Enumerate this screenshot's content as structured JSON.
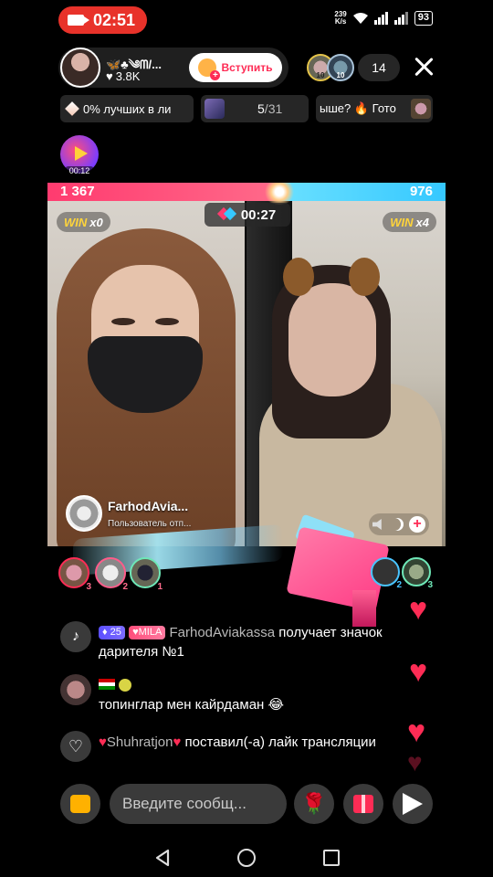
{
  "status_bar": {
    "recording_time": "02:51",
    "net_speed_value": "239",
    "net_speed_unit": "K/s",
    "battery": "93"
  },
  "host": {
    "name": "🦋♣༄ᗰ/...",
    "likes": "3.8K",
    "join_label": "Вступить"
  },
  "viewers": {
    "badge_1": "10",
    "badge_2": "10",
    "count": "14"
  },
  "chips": {
    "rank_text": "0% лучших в ли",
    "goal_progress": "5",
    "goal_total": "31",
    "ticker_text": "ыше? 🔥 Гото"
  },
  "live_badge_time": "00:12",
  "battle": {
    "score_left": "1 367",
    "score_right": "976",
    "score_left_share": 0.583,
    "timer": "00:27",
    "win_word": "WIN",
    "win_left": "x0",
    "win_right": "x4",
    "opponent_name": "FarhodAvia...",
    "opponent_sub": "Пользователь отп..."
  },
  "gifters": {
    "ranks": [
      "3",
      "2",
      "1"
    ],
    "right_ranks": [
      "2",
      "3"
    ]
  },
  "chat": [
    {
      "level": "25",
      "fan_badge": "MILA",
      "user": "FarhodAviakassa",
      "message": " получает значок дарителя №1"
    },
    {
      "message": "топинглар мен кайрдаман 😂"
    },
    {
      "user": "Shuhratjon",
      "message": " поставил(-а) лайк трансляции"
    }
  ],
  "input": {
    "placeholder": "Введите сообщ..."
  },
  "icons": {
    "rose": "🌹",
    "heart": "♥"
  },
  "colors": {
    "accent": "#fe2c55",
    "score_left": "#ff3b6f",
    "score_right": "#35c8ff",
    "win": "#ffd43b"
  }
}
